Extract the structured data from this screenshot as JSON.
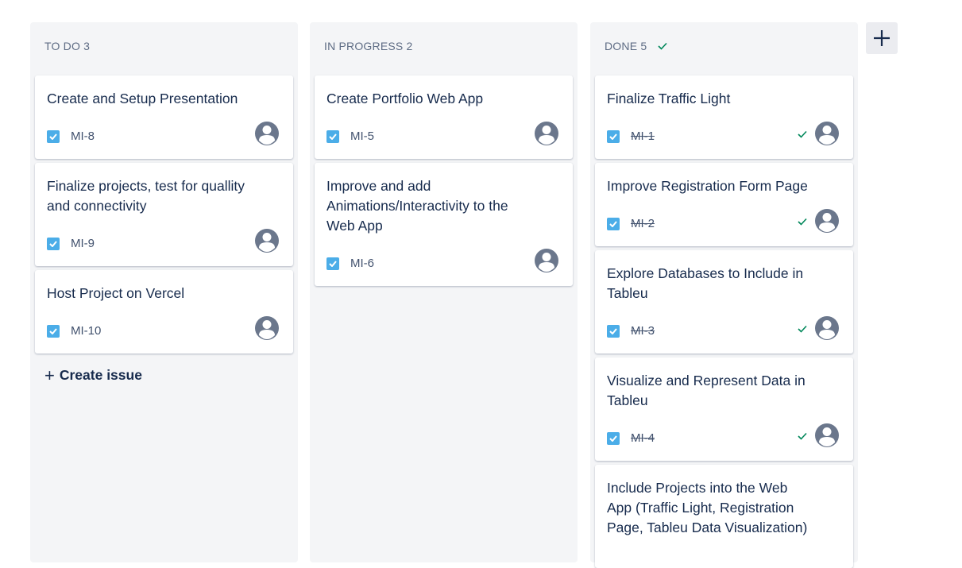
{
  "columns": [
    {
      "title": "TO DO 3",
      "cards": [
        {
          "title": "Create and Setup Presentation",
          "key": "MI-8"
        },
        {
          "title": "Finalize projects, test for quallity and connectivity",
          "key": "MI-9"
        },
        {
          "title": "Host Project on Vercel",
          "key": "MI-10"
        }
      ],
      "create_label": "Create issue"
    },
    {
      "title": "IN PROGRESS 2",
      "cards": [
        {
          "title": "Create Portfolio Web App",
          "key": "MI-5"
        },
        {
          "title": "Improve and add Animations/Interactivity to the Web App",
          "key": "MI-6"
        }
      ]
    },
    {
      "title": "DONE 5",
      "cards": [
        {
          "title": "Finalize Traffic Light",
          "key": "MI-1"
        },
        {
          "title": "Improve Registration Form Page",
          "key": "MI-2"
        },
        {
          "title": "Explore Databases to Include in Tableu",
          "key": "MI-3"
        },
        {
          "title": "Visualize and Represent Data in Tableu",
          "key": "MI-4"
        },
        {
          "title": "Include Projects into the Web App (Traffic Light, Registration Page, Tableu Data Visualization)",
          "key": ""
        }
      ]
    }
  ],
  "icons": {
    "issue_type": "checkbox-icon",
    "assignee": "avatar-icon",
    "resolved": "check-icon",
    "add_column": "plus-icon"
  },
  "colors": {
    "column_bg": "#f4f5f7",
    "task_icon": "#4bade8",
    "done_green": "#00875a",
    "avatar": "#6b778c"
  }
}
